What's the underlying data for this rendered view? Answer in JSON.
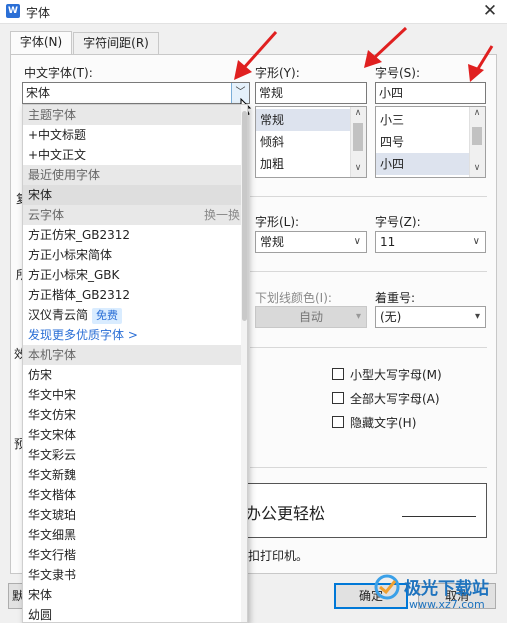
{
  "window": {
    "title": "字体",
    "app_icon": "W",
    "close_glyph": "✕"
  },
  "tabs": [
    {
      "label": "字体(N)"
    },
    {
      "label": "字符间距(R)"
    }
  ],
  "chinese_font": {
    "label": "中文字体(T):",
    "value": "宋体",
    "toggle_glyph": "﹀"
  },
  "style": {
    "label": "字形(Y):",
    "value": "常规",
    "options": [
      "常规",
      "倾斜",
      "加粗"
    ]
  },
  "size": {
    "label": "字号(S):",
    "value": "小四",
    "options": [
      "小三",
      "四号",
      "小四"
    ]
  },
  "latin": {
    "style_label": "字形(L):",
    "style_value": "常规",
    "size_label": "字号(Z):",
    "size_value": "11"
  },
  "underline": {
    "color_label": "下划线颜色(I):",
    "color_value": "自动"
  },
  "emphasis": {
    "label": "着重号:",
    "value": "(无)"
  },
  "effects": [
    {
      "label": "小型大写字母(M)"
    },
    {
      "label": "全部大写字母(A)"
    },
    {
      "label": "隐藏文字(H)"
    }
  ],
  "preview": {
    "text": "办公更轻松",
    "note": "扣打印机。"
  },
  "buttons": {
    "ok": "确定",
    "cancel": "取消"
  },
  "dropdown": {
    "items": [
      {
        "text": "主题字体",
        "kind": "hdr"
      },
      {
        "text": "+中文标题",
        "kind": "item"
      },
      {
        "text": "+中文正文",
        "kind": "item"
      },
      {
        "text": "最近使用字体",
        "kind": "hdr"
      },
      {
        "text": "宋体",
        "kind": "current"
      },
      {
        "text": "云字体",
        "kind": "hdr",
        "right": "换一换"
      },
      {
        "text": "方正仿宋_GB2312",
        "kind": "item"
      },
      {
        "text": "方正小标宋简体",
        "kind": "item"
      },
      {
        "text": "方正小标宋_GBK",
        "kind": "item"
      },
      {
        "text": "方正楷体_GB2312",
        "kind": "item"
      },
      {
        "text": "汉仪青云简",
        "kind": "item",
        "badge": "免费"
      },
      {
        "text": "发现更多优质字体 >",
        "kind": "link"
      },
      {
        "text": "本机字体",
        "kind": "hdr"
      },
      {
        "text": "仿宋",
        "kind": "item"
      },
      {
        "text": "华文中宋",
        "kind": "item"
      },
      {
        "text": "华文仿宋",
        "kind": "item"
      },
      {
        "text": "华文宋体",
        "kind": "item"
      },
      {
        "text": "华文彩云",
        "kind": "item"
      },
      {
        "text": "华文新魏",
        "kind": "item"
      },
      {
        "text": "华文楷体",
        "kind": "item"
      },
      {
        "text": "华文琥珀",
        "kind": "item"
      },
      {
        "text": "华文细黑",
        "kind": "item"
      },
      {
        "text": "华文行楷",
        "kind": "item"
      },
      {
        "text": "华文隶书",
        "kind": "item"
      },
      {
        "text": "宋体",
        "kind": "item"
      },
      {
        "text": "幼圆",
        "kind": "item"
      }
    ]
  },
  "hidden_labels": {
    "l1": "复",
    "l2": "所",
    "l3": "效",
    "l4": "预",
    "l5": "默"
  },
  "watermark": {
    "name": "极光下载站",
    "url": "www.xz7.com"
  },
  "colors": {
    "accent": "#0078d7",
    "arrow": "#e02020",
    "link": "#2b6fd6"
  }
}
